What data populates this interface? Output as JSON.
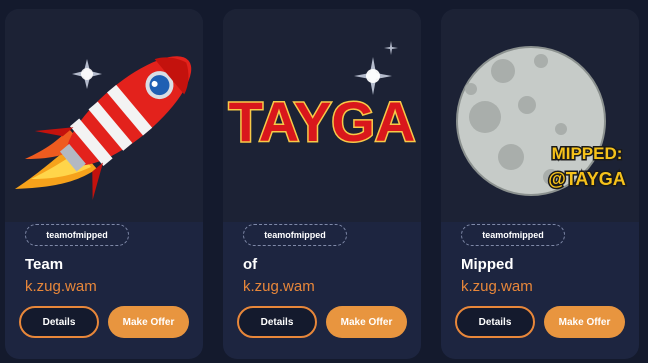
{
  "colors": {
    "page_bg": "#141a2d",
    "card_bg": "#1d2540",
    "accent": "#e8873a",
    "button_fill": "#e8953f"
  },
  "cards": [
    {
      "tag": "teamofmipped",
      "title": "Team",
      "subtitle": "k.zug.wam",
      "image": "rocket-icon",
      "details_label": "Details",
      "offer_label": "Make Offer"
    },
    {
      "tag": "teamofmipped",
      "title": "of",
      "subtitle": "k.zug.wam",
      "image": "tayga-logo",
      "image_text": "TAYGA",
      "details_label": "Details",
      "offer_label": "Make Offer"
    },
    {
      "tag": "teamofmipped",
      "title": "Mipped",
      "subtitle": "k.zug.wam",
      "image": "moon-icon",
      "image_text_1": "MIPPED:",
      "image_text_2": "@TAYGA",
      "details_label": "Details",
      "offer_label": "Make Offer"
    }
  ]
}
